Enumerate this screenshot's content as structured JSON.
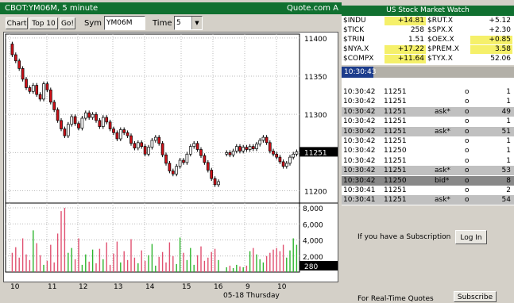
{
  "left": {
    "title": "CBOT:YM06M, 5 minute",
    "brand": "Quote.com",
    "brand_suffix": "A",
    "buttons": {
      "chart": "Chart",
      "top10": "Top 10",
      "go": "Go!"
    },
    "sym_label": "Sym",
    "sym_value": "YM06M",
    "time_label": "Time",
    "time_value": "5",
    "dropdown_arrow": "▼"
  },
  "chart_data": {
    "type": "candlestick",
    "price_axis": {
      "ticks": [
        "11400",
        "11350",
        "11300",
        "11250",
        "11200"
      ],
      "ylim": [
        11185,
        11405
      ]
    },
    "last_price": "11251",
    "volume_axis": {
      "ticks": [
        "8,000",
        "6,000",
        "4,000",
        "2,000"
      ],
      "ylim": [
        0,
        8500
      ]
    },
    "last_volume": "280",
    "x_ticks": [
      "10",
      "11",
      "12",
      "13",
      "14",
      "15",
      "16",
      "9",
      "10"
    ],
    "x_sublabel": "05-18 Thursday",
    "price_path": [
      11392,
      11378,
      11370,
      11360,
      11346,
      11335,
      11330,
      11338,
      11326,
      11320,
      11340,
      11332,
      11316,
      11306,
      11292,
      11281,
      11272,
      11287,
      11297,
      11288,
      11282,
      11295,
      11302,
      11296,
      11300,
      11292,
      11284,
      11296,
      11290,
      11281,
      11276,
      11268,
      11280,
      11276,
      11272,
      11262,
      11256,
      11263,
      11258,
      11248,
      11257,
      11266,
      11270,
      11262,
      11247,
      11236,
      11226,
      11222,
      11232,
      11240,
      11237,
      11248,
      11258,
      11262,
      11254,
      11246,
      11237,
      11227,
      11216,
      11208,
      11212
    ],
    "price_path2": [
      11248,
      11250,
      11247,
      11252,
      11258,
      11252,
      11257,
      11254,
      11258,
      11255,
      11261,
      11266,
      11270,
      11263,
      11252,
      11248,
      11244,
      11238,
      11232,
      11236,
      11244,
      11248,
      11251
    ],
    "volumes": [
      2400,
      3100,
      1800,
      4200,
      2200,
      1500,
      5200,
      3600,
      2100,
      900,
      1400,
      3400,
      1200,
      4800,
      7600,
      8000,
      2400,
      3000,
      1600,
      4200,
      900,
      2200,
      1300,
      2800,
      1100,
      2900,
      1600,
      3700,
      900,
      2300,
      3800,
      1200,
      2600,
      1500,
      4100,
      1800,
      1100,
      2700,
      1400,
      2100,
      3500,
      800,
      1900,
      2500,
      1200,
      3700,
      2000,
      1000,
      4300,
      2400,
      1500,
      3000,
      900,
      2100,
      3200,
      1400,
      1800,
      2500,
      2900,
      1500,
      1200
    ],
    "volumes2": [
      600,
      800,
      500,
      900,
      700,
      600,
      800,
      2600,
      3000,
      2200,
      1600,
      1200,
      2000,
      2400,
      2800,
      3000,
      2600,
      3400,
      1800,
      2700,
      4200,
      3400,
      2200
    ]
  },
  "right": {
    "watch_title": "US Stock Market Watch",
    "watch": [
      {
        "sym1": "$INDU",
        "val1": "+14.81",
        "sym2": "$RUT.X",
        "val2": "+5.12"
      },
      {
        "sym1": "$TICK",
        "val1": "258",
        "sym2": "$SPX.X",
        "val2": "+2.30"
      },
      {
        "sym1": "$TRIN",
        "val1": "1.51",
        "sym2": "$OEX.X",
        "val2": "+0.85"
      },
      {
        "sym1": "$NYA.X",
        "val1": "+17.22",
        "sym2": "$PREM.X",
        "val2": "3.58"
      },
      {
        "sym1": "$COMPX",
        "val1": "+11.64",
        "sym2": "$TYX.X",
        "val2": "52.06"
      }
    ],
    "ts_time": "10:30:43",
    "trades": [
      {
        "time": "10:30:42",
        "price": "11251",
        "side": "",
        "o": "o",
        "size": "1"
      },
      {
        "time": "10:30:42",
        "price": "11251",
        "side": "",
        "o": "o",
        "size": "1"
      },
      {
        "time": "10:30:42",
        "price": "11251",
        "side": "ask*",
        "o": "o",
        "size": "49"
      },
      {
        "time": "10:30:42",
        "price": "11251",
        "side": "",
        "o": "o",
        "size": "1"
      },
      {
        "time": "10:30:42",
        "price": "11251",
        "side": "ask*",
        "o": "o",
        "size": "51"
      },
      {
        "time": "10:30:42",
        "price": "11251",
        "side": "",
        "o": "o",
        "size": "1"
      },
      {
        "time": "10:30:42",
        "price": "11250",
        "side": "",
        "o": "o",
        "size": "1"
      },
      {
        "time": "10:30:42",
        "price": "11251",
        "side": "",
        "o": "o",
        "size": "1"
      },
      {
        "time": "10:30:42",
        "price": "11251",
        "side": "ask*",
        "o": "o",
        "size": "53"
      },
      {
        "time": "10:30:42",
        "price": "11250",
        "side": "bid*",
        "o": "o",
        "size": "8"
      },
      {
        "time": "10:30:41",
        "price": "11251",
        "side": "",
        "o": "o",
        "size": "2"
      },
      {
        "time": "10:30:41",
        "price": "11251",
        "side": "ask*",
        "o": "o",
        "size": "54"
      }
    ],
    "subscription_text": "If you have a Subscription",
    "login_label": "Log In",
    "realtime_text": "For Real-Time Quotes",
    "subscribe_label": "Subscribe"
  },
  "colors": {
    "green": "#107030",
    "up": "#ffffff",
    "down": "#d01018",
    "vol_up": "#2db52d",
    "vol_down": "#e05070",
    "highlight": "#f5f06a"
  }
}
